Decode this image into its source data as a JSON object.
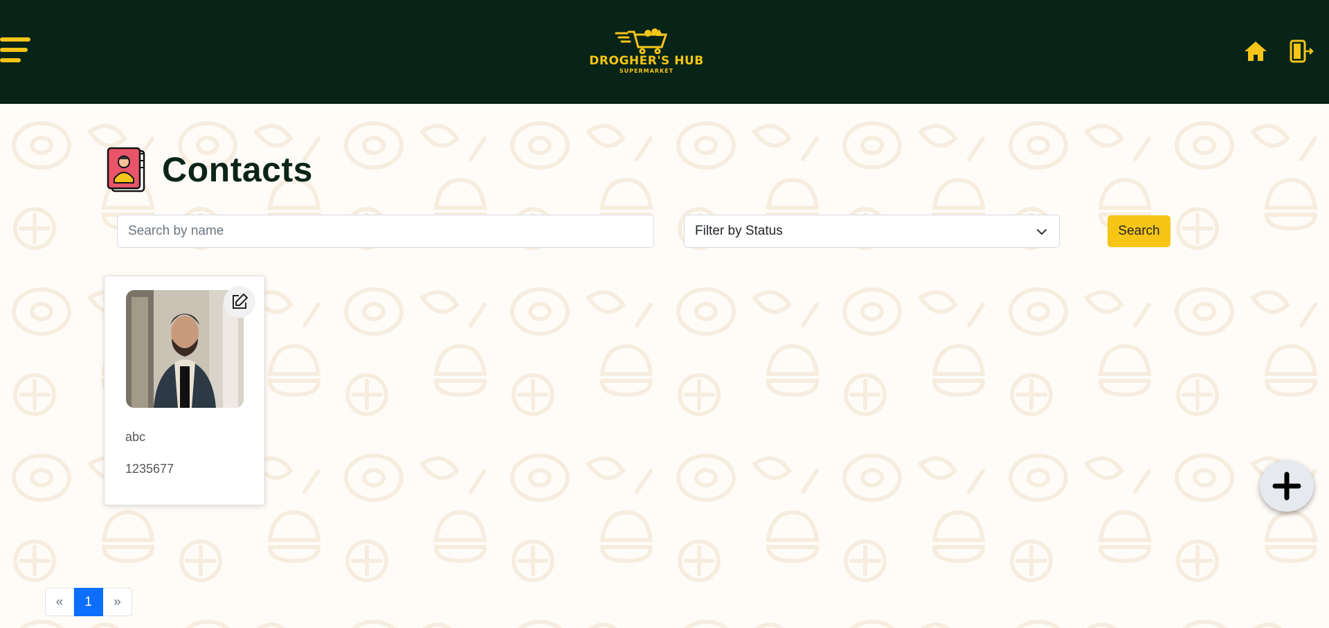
{
  "header": {
    "logo_title": "DROGHER'S HUB",
    "logo_subtitle": "SUPERMARKET"
  },
  "page": {
    "title": "Contacts"
  },
  "filters": {
    "search_placeholder": "Search by name",
    "status_selected": "Filter by Status",
    "search_button": "Search"
  },
  "contacts": [
    {
      "name": "abc",
      "phone": "1235677"
    }
  ],
  "pagination": {
    "prev": "«",
    "pages": [
      "1"
    ],
    "next": "»"
  },
  "colors": {
    "header_bg": "#082418",
    "accent": "#f5c518",
    "active_page": "#0d6efd"
  },
  "icons": [
    "hamburger-menu-icon",
    "cart-logo-icon",
    "home-icon",
    "logout-icon",
    "contacts-book-icon",
    "edit-icon",
    "chevron-down-icon",
    "plus-icon"
  ]
}
